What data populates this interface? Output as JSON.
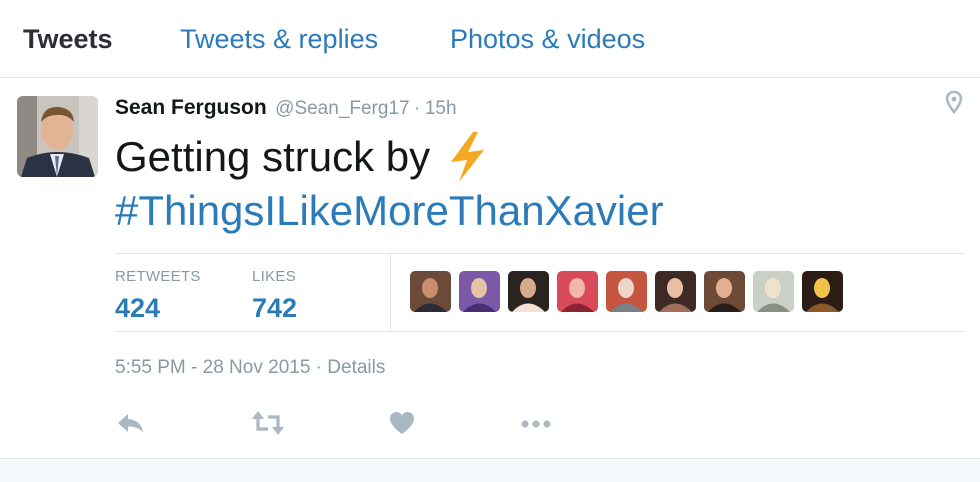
{
  "tabs": [
    {
      "label": "Tweets"
    },
    {
      "label": "Tweets & replies"
    },
    {
      "label": "Photos & videos"
    }
  ],
  "tweet": {
    "fullname": "Sean Ferguson",
    "handle": "@Sean_Ferg17",
    "separator": "·",
    "time": "15h",
    "text": "Getting struck by",
    "emoji_icon": "lightning-bolt-icon",
    "hashtag": "#ThingsILikeMoreThanXavier",
    "retweets_label": "RETWEETS",
    "retweets_count": "424",
    "likes_label": "LIKES",
    "likes_count": "742",
    "timestamp": "5:55 PM - 28 Nov 2015",
    "details_label": "Details",
    "liker_avatar_count": 9
  },
  "icons": [
    "geo-pin-icon",
    "reply-icon",
    "retweet-icon",
    "heart-icon",
    "more-icon"
  ],
  "colors": {
    "link_blue": "#2b7bb9",
    "muted_gray": "#8899a6",
    "icon_gray": "#aab8c2",
    "bolt_orange": "#f4a922",
    "divider": "#e1e8ed"
  }
}
